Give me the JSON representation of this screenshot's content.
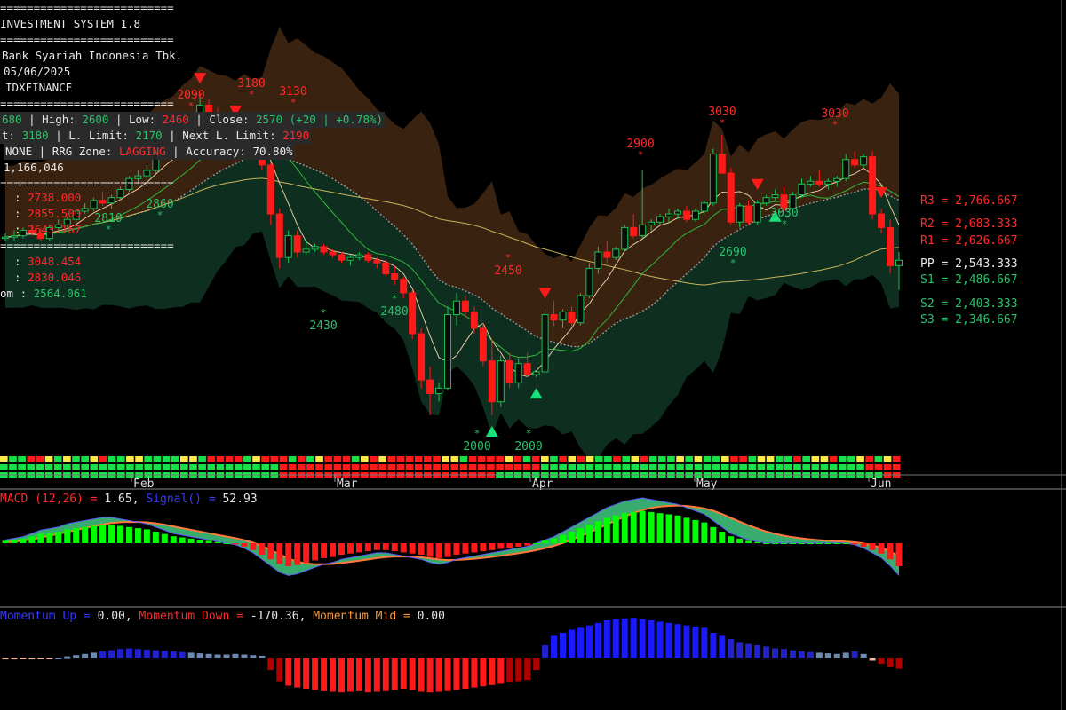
{
  "header": {
    "sep": "==========================",
    "system_name": "INVESTMENT SYSTEM 1.8",
    "company": "Bank Syariah Indonesia Tbk.",
    "date": "05/06/2025",
    "sector": "IDXFINANCE",
    "ohlc": {
      "open_label": "Open:",
      "open_partial": "680",
      "high_label": "High:",
      "high": "2600",
      "low_label": "Low:",
      "low": "2460",
      "close_label": "Close:",
      "close": "2570",
      "change": "(+20 | +0.78%)"
    },
    "limits": {
      "u_label": "t:",
      "u_value": "3180",
      "l_label": "L. Limit:",
      "l_value": "2170",
      "nl_label": "Next L. Limit:",
      "nl_value": "2190"
    },
    "zone": {
      "status": "NONE",
      "rrg_label": "RRG Zone:",
      "rrg_value": "LAGGING",
      "acc_label": "Accuracy:",
      "acc_value": "70.80%"
    },
    "volume": "1,166,046",
    "levels_a": [
      "2738.000",
      "2855.500",
      "2643.167"
    ],
    "levels_b": [
      "3048.454",
      "2830.046",
      "2564.061"
    ],
    "levels_b_label": "om :"
  },
  "pivots": {
    "R3": "2,766.667",
    "R2": "2,683.333",
    "R1": "2,626.667",
    "PP": "2,543.333",
    "S1": "2,486.667",
    "S2": "2,403.333",
    "S3": "2,346.667",
    "labels": {
      "R3": "R3 =",
      "R2": "R2 =",
      "R1": "R1 =",
      "PP": "PP =",
      "S1": "S1 =",
      "S2": "S2 =",
      "S3": "S3 ="
    }
  },
  "macd": {
    "label": "MACD (12,26) = ",
    "value": "1.65",
    "signal_label": "Signal() = ",
    "signal_value": "52.93"
  },
  "momentum": {
    "up_label": "Momentum Up = ",
    "up_value": "0.00",
    "down_label": "Momentum Down = ",
    "down_value": "-170.36",
    "mid_label": "Momentum Mid = ",
    "mid_value": "0.00"
  },
  "colors": {
    "up": "#18c24f",
    "down": "#ff1a1a",
    "upper_band": "#3a2210",
    "lower_band": "#0e2e1f",
    "macd_pos": "#00ff00",
    "macd_neg": "#ff1a1a",
    "mom_up": "#1a1aff",
    "mom_down": "#ff1a1a"
  },
  "chart_data": {
    "type": "candlestick",
    "x_ticks": [
      "Feb",
      "Mar",
      "Apr",
      "May",
      "Jun"
    ],
    "price_annotations": [
      "2090",
      "3180",
      "3130",
      "2810",
      "2860",
      "2430",
      "2480",
      "2450",
      "2000",
      "2000",
      "2900",
      "3030",
      "3030",
      "2690",
      "3030"
    ],
    "candles": [
      [
        2650,
        2670,
        2640,
        2655
      ],
      [
        2655,
        2680,
        2640,
        2660
      ],
      [
        2660,
        2690,
        2650,
        2680
      ],
      [
        2680,
        2700,
        2660,
        2670
      ],
      [
        2670,
        2690,
        2640,
        2650
      ],
      [
        2650,
        2700,
        2640,
        2690
      ],
      [
        2690,
        2720,
        2680,
        2700
      ],
      [
        2700,
        2730,
        2690,
        2720
      ],
      [
        2720,
        2760,
        2710,
        2750
      ],
      [
        2750,
        2780,
        2740,
        2760
      ],
      [
        2760,
        2800,
        2750,
        2790
      ],
      [
        2790,
        2820,
        2770,
        2780
      ],
      [
        2780,
        2810,
        2760,
        2800
      ],
      [
        2800,
        2840,
        2790,
        2830
      ],
      [
        2830,
        2880,
        2820,
        2870
      ],
      [
        2870,
        2900,
        2850,
        2880
      ],
      [
        2880,
        2920,
        2860,
        2900
      ],
      [
        2900,
        2960,
        2890,
        2950
      ],
      [
        2950,
        3000,
        2940,
        2980
      ],
      [
        2980,
        3020,
        2960,
        3000
      ],
      [
        3000,
        3060,
        2990,
        3050
      ],
      [
        3050,
        3100,
        3030,
        3080
      ],
      [
        3080,
        3180,
        3060,
        3140
      ],
      [
        3140,
        3160,
        3080,
        3100
      ],
      [
        3100,
        3130,
        3040,
        3060
      ],
      [
        3060,
        3100,
        3020,
        3040
      ],
      [
        3040,
        3060,
        2990,
        3000
      ],
      [
        3000,
        3040,
        2980,
        3030
      ],
      [
        3030,
        3050,
        2980,
        2990
      ],
      [
        2990,
        3010,
        2900,
        2920
      ],
      [
        2920,
        2930,
        2700,
        2740
      ],
      [
        2740,
        2760,
        2540,
        2580
      ],
      [
        2580,
        2680,
        2560,
        2660
      ],
      [
        2660,
        2680,
        2580,
        2600
      ],
      [
        2600,
        2640,
        2590,
        2610
      ],
      [
        2610,
        2630,
        2600,
        2620
      ],
      [
        2620,
        2630,
        2590,
        2600
      ],
      [
        2600,
        2610,
        2580,
        2590
      ],
      [
        2590,
        2600,
        2560,
        2570
      ],
      [
        2570,
        2590,
        2550,
        2580
      ],
      [
        2580,
        2600,
        2570,
        2590
      ],
      [
        2590,
        2600,
        2560,
        2570
      ],
      [
        2570,
        2580,
        2540,
        2560
      ],
      [
        2560,
        2570,
        2510,
        2520
      ],
      [
        2520,
        2550,
        2480,
        2500
      ],
      [
        2500,
        2510,
        2430,
        2450
      ],
      [
        2450,
        2460,
        2280,
        2300
      ],
      [
        2300,
        2320,
        2100,
        2130
      ],
      [
        2130,
        2180,
        2000,
        2080
      ],
      [
        2080,
        2120,
        2050,
        2100
      ],
      [
        2100,
        2400,
        2090,
        2370
      ],
      [
        2370,
        2450,
        2330,
        2420
      ],
      [
        2420,
        2440,
        2360,
        2380
      ],
      [
        2380,
        2400,
        2300,
        2320
      ],
      [
        2320,
        2340,
        2180,
        2200
      ],
      [
        2200,
        2280,
        2000,
        2050
      ],
      [
        2050,
        2220,
        2030,
        2200
      ],
      [
        2200,
        2230,
        2100,
        2120
      ],
      [
        2120,
        2210,
        2100,
        2190
      ],
      [
        2190,
        2230,
        2140,
        2150
      ],
      [
        2150,
        2160,
        2140,
        2160
      ],
      [
        2160,
        2390,
        2150,
        2370
      ],
      [
        2370,
        2420,
        2330,
        2350
      ],
      [
        2350,
        2390,
        2320,
        2380
      ],
      [
        2380,
        2400,
        2330,
        2340
      ],
      [
        2340,
        2450,
        2330,
        2440
      ],
      [
        2440,
        2560,
        2430,
        2540
      ],
      [
        2540,
        2620,
        2520,
        2600
      ],
      [
        2600,
        2640,
        2560,
        2580
      ],
      [
        2580,
        2620,
        2570,
        2610
      ],
      [
        2610,
        2700,
        2600,
        2690
      ],
      [
        2690,
        2740,
        2650,
        2660
      ],
      [
        2660,
        2900,
        2650,
        2700
      ],
      [
        2700,
        2720,
        2680,
        2710
      ],
      [
        2710,
        2740,
        2700,
        2730
      ],
      [
        2730,
        2760,
        2710,
        2740
      ],
      [
        2740,
        2760,
        2720,
        2750
      ],
      [
        2750,
        2770,
        2710,
        2720
      ],
      [
        2720,
        2760,
        2710,
        2750
      ],
      [
        2750,
        2790,
        2740,
        2780
      ],
      [
        2780,
        2980,
        2770,
        2960
      ],
      [
        2960,
        3030,
        2890,
        2890
      ],
      [
        2890,
        2910,
        2700,
        2710
      ],
      [
        2710,
        2780,
        2690,
        2770
      ],
      [
        2770,
        2790,
        2700,
        2710
      ],
      [
        2710,
        2790,
        2700,
        2780
      ],
      [
        2780,
        2810,
        2770,
        2800
      ],
      [
        2800,
        2830,
        2790,
        2810
      ],
      [
        2810,
        2840,
        2750,
        2760
      ],
      [
        2760,
        2820,
        2750,
        2810
      ],
      [
        2810,
        2870,
        2800,
        2850
      ],
      [
        2850,
        2880,
        2840,
        2860
      ],
      [
        2860,
        2900,
        2840,
        2850
      ],
      [
        2850,
        2870,
        2830,
        2860
      ],
      [
        2860,
        2880,
        2840,
        2870
      ],
      [
        2870,
        2960,
        2860,
        2940
      ],
      [
        2940,
        2970,
        2910,
        2920
      ],
      [
        2920,
        2960,
        2910,
        2950
      ],
      [
        2950,
        2970,
        2720,
        2740
      ],
      [
        2740,
        2760,
        2670,
        2690
      ],
      [
        2690,
        2720,
        2520,
        2550
      ],
      [
        2550,
        2600,
        2460,
        2570
      ]
    ],
    "macd_hist": [
      2,
      3,
      4,
      6,
      8,
      9,
      10,
      12,
      13,
      14,
      15,
      16,
      16,
      15,
      14,
      13,
      12,
      10,
      8,
      6,
      5,
      4,
      3,
      2,
      1,
      0,
      -1,
      -3,
      -6,
      -10,
      -14,
      -18,
      -20,
      -19,
      -17,
      -15,
      -13,
      -12,
      -10,
      -9,
      -8,
      -7,
      -6,
      -6,
      -7,
      -8,
      -9,
      -10,
      -12,
      -13,
      -12,
      -10,
      -9,
      -8,
      -7,
      -6,
      -5,
      -4,
      -3,
      -2,
      0,
      2,
      4,
      7,
      10,
      13,
      16,
      19,
      22,
      24,
      26,
      27,
      28,
      27,
      26,
      25,
      24,
      22,
      20,
      18,
      14,
      10,
      6,
      4,
      2,
      1,
      0,
      0,
      0,
      0,
      0,
      0,
      0,
      0,
      0,
      0,
      -1,
      -3,
      -6,
      -9,
      -14,
      -20
    ],
    "mom_values": [
      -3,
      -3,
      -2,
      -3,
      -2,
      -1,
      0,
      2,
      4,
      6,
      8,
      10,
      12,
      14,
      15,
      14,
      13,
      12,
      11,
      10,
      9,
      8,
      7,
      6,
      5,
      5,
      6,
      5,
      4,
      3,
      -20,
      -38,
      -45,
      -48,
      -50,
      -52,
      -54,
      -55,
      -56,
      -55,
      -54,
      -56,
      -55,
      -54,
      -52,
      -50,
      -52,
      -55,
      -56,
      -55,
      -54,
      -52,
      -50,
      -48,
      -46,
      -44,
      -42,
      -40,
      -38,
      -36,
      -20,
      20,
      35,
      40,
      45,
      48,
      52,
      56,
      60,
      62,
      63,
      64,
      62,
      60,
      58,
      56,
      54,
      52,
      50,
      48,
      40,
      35,
      30,
      25,
      22,
      20,
      18,
      15,
      14,
      12,
      10,
      9,
      8,
      7,
      6,
      8,
      10,
      6,
      -5,
      -10,
      -15,
      -18
    ]
  }
}
